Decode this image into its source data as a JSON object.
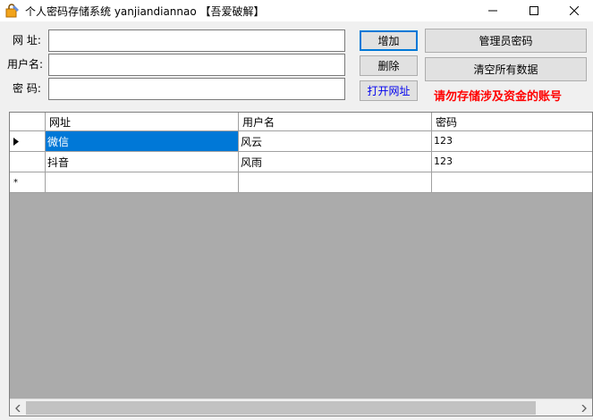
{
  "window": {
    "title": "个人密码存储系统 yanjiandiannao 【吾爱破解】"
  },
  "form": {
    "url_label": "网 址:",
    "username_label": "用户名:",
    "password_label": "密 码:",
    "url_value": "",
    "username_value": "",
    "password_value": ""
  },
  "buttons": {
    "add": "增加",
    "delete": "删除",
    "open_url": "打开网址",
    "admin_password": "管理员密码",
    "clear_all": "清空所有数据"
  },
  "warning": "请勿存储涉及资金的账号",
  "grid": {
    "columns": [
      "网址",
      "用户名",
      "密码"
    ],
    "rows": [
      {
        "url": "微信",
        "username": "风云",
        "password": "123"
      },
      {
        "url": "抖音",
        "username": "风雨",
        "password": "123"
      }
    ],
    "new_row_marker": "*"
  },
  "colors": {
    "accent": "#0078d7",
    "warning": "#ff0000",
    "grid_background": "#ababab"
  }
}
